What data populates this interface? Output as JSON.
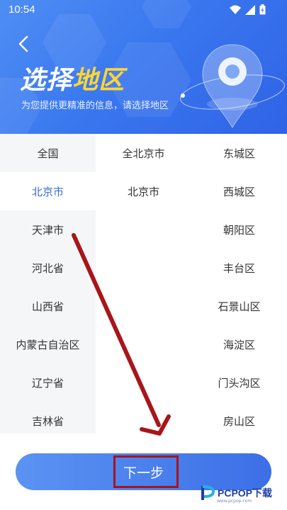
{
  "status_bar": {
    "time": "10:54"
  },
  "header": {
    "title_part1": "选择",
    "title_part2": "地区",
    "subtitle": "为您提供更精准的信息，请选择地区"
  },
  "provinces": [
    {
      "label": "全国",
      "selected": false
    },
    {
      "label": "北京市",
      "selected": true
    },
    {
      "label": "天津市",
      "selected": false
    },
    {
      "label": "河北省",
      "selected": false
    },
    {
      "label": "山西省",
      "selected": false
    },
    {
      "label": "内蒙古自治区",
      "selected": false
    },
    {
      "label": "辽宁省",
      "selected": false
    },
    {
      "label": "吉林省",
      "selected": false
    }
  ],
  "cities": [
    {
      "label": "全北京市"
    },
    {
      "label": "北京市"
    }
  ],
  "districts": [
    {
      "label": "东城区"
    },
    {
      "label": "西城区"
    },
    {
      "label": "朝阳区"
    },
    {
      "label": "丰台区"
    },
    {
      "label": "石景山区"
    },
    {
      "label": "海淀区"
    },
    {
      "label": "门头沟区"
    },
    {
      "label": "房山区"
    }
  ],
  "next_button_label": "下一步",
  "watermark": {
    "brand": "PCPOP下载",
    "sub": "www.pcpop.com"
  },
  "colors": {
    "header": "#3a78ef",
    "accent": "#3a6fd8",
    "highlight": "#ffd633",
    "annotation": "#a8151a"
  }
}
